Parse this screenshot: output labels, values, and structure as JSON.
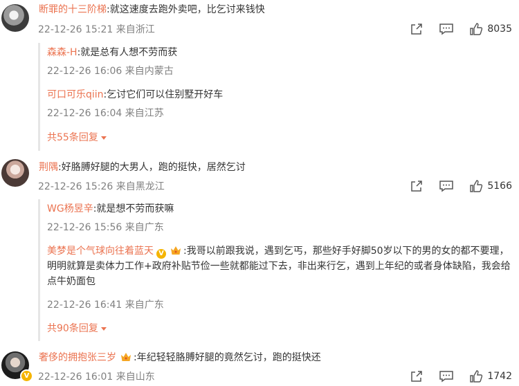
{
  "comments": [
    {
      "username": "断罪的十三阶梯",
      "content": ":就这速度去跑外卖吧，比乞讨来钱快",
      "meta": "22-12-26 15:21 来自浙江",
      "likes": "8035",
      "replies": [
        {
          "username": "森森-H",
          "content": ":就是总有人想不劳而获",
          "meta": "22-12-26 16:06 来自内蒙古"
        },
        {
          "username": "可口可乐qiin",
          "content": ":乞讨它们可以住别墅开好车",
          "meta": "22-12-26 16:04 来自江苏"
        }
      ],
      "more_replies": "共55条回复"
    },
    {
      "username": "荆隅",
      "content": ":好胳膊好腿的大男人，跑的挺快，居然乞讨",
      "meta": "22-12-26 15:26 来自黑龙江",
      "likes": "5166",
      "replies": [
        {
          "username": "WG杨昱辛",
          "content": ":就是想不劳而获嘛",
          "meta": "22-12-26 15:56 来自广东"
        },
        {
          "username": "美梦是个气球向往着蓝天",
          "content": ":我哥以前跟我说，遇到乞丐，那些好手好脚50岁以下的男的女的都不要理，明明就算是卖体力工作+政府补贴节俭一些就都能过下去，非出来行乞，遇到上年纪的或者身体缺陷，我会给点牛奶面包",
          "meta": "22-12-26 16:41 来自广东"
        }
      ],
      "more_replies": "共90条回复"
    },
    {
      "username": "奢侈的拥抱张三岁",
      "content": ":年纪轻轻胳膊好腿的竟然乞讨，跑的挺快还",
      "meta": "22-12-26 16:01 来自山东",
      "likes": "1742"
    }
  ]
}
